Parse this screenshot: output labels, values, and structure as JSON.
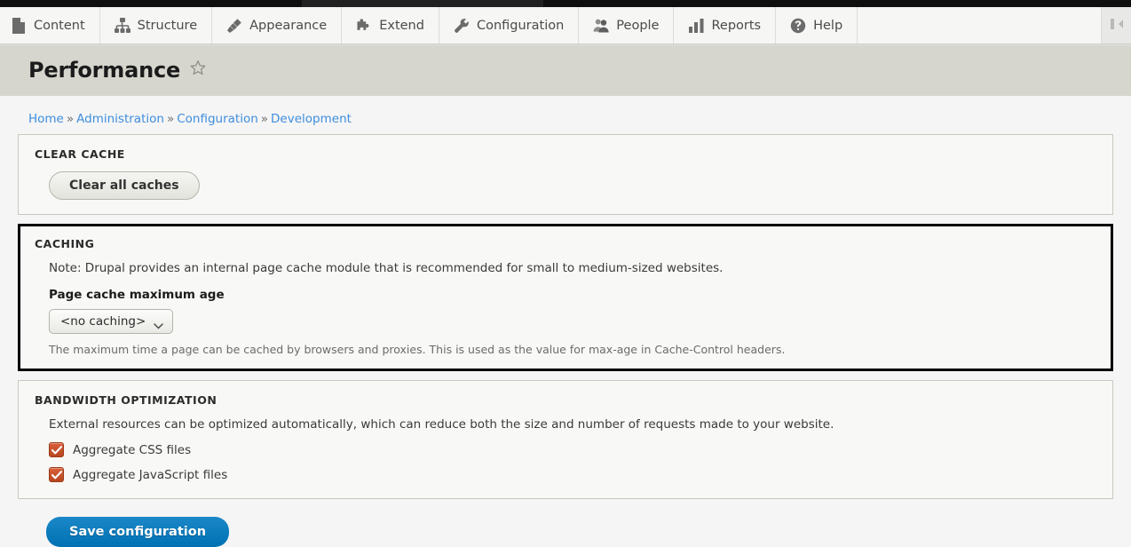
{
  "toolbar": {
    "items": [
      {
        "label": "Content",
        "icon": "file-icon"
      },
      {
        "label": "Structure",
        "icon": "hierarchy-icon"
      },
      {
        "label": "Appearance",
        "icon": "paintbrush-icon"
      },
      {
        "label": "Extend",
        "icon": "puzzle-piece-icon"
      },
      {
        "label": "Configuration",
        "icon": "wrench-icon"
      },
      {
        "label": "People",
        "icon": "people-icon"
      },
      {
        "label": "Reports",
        "icon": "bar-chart-icon"
      },
      {
        "label": "Help",
        "icon": "question-circle-icon"
      }
    ],
    "collapse_icon": "collapse-toolbar-icon"
  },
  "header": {
    "title": "Performance",
    "favorite_icon": "star-outline-icon"
  },
  "breadcrumb": {
    "separator": "»",
    "items": [
      "Home",
      "Administration",
      "Configuration",
      "Development"
    ]
  },
  "clear_cache": {
    "legend": "CLEAR CACHE",
    "button_label": "Clear all caches"
  },
  "caching": {
    "legend": "CACHING",
    "note": "Note: Drupal provides an internal page cache module that is recommended for small to medium-sized websites.",
    "field_label": "Page cache maximum age",
    "selected_value": "<no caching>",
    "description": "The maximum time a page can be cached by browsers and proxies. This is used as the value for max-age in Cache-Control headers."
  },
  "bandwidth": {
    "legend": "BANDWIDTH OPTIMIZATION",
    "description": "External resources can be optimized automatically, which can reduce both the size and number of requests made to your website.",
    "checkboxes": [
      {
        "label": "Aggregate CSS files",
        "checked": true
      },
      {
        "label": "Aggregate JavaScript files",
        "checked": true
      }
    ]
  },
  "actions": {
    "save_label": "Save configuration"
  },
  "colors": {
    "accent_blue": "#0071b3",
    "link_blue": "#3e8ede",
    "checkbox_orange": "#b8461f",
    "title_band": "#d6d6ce"
  }
}
